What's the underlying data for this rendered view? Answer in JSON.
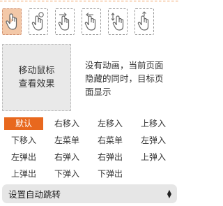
{
  "gestures": [
    {
      "icon": "hand-tap-icon",
      "active": true
    },
    {
      "icon": "hand-tap-circle-icon",
      "active": false
    },
    {
      "icon": "hand-swipe-right-icon",
      "active": false
    },
    {
      "icon": "hand-swipe-left-icon",
      "active": false
    },
    {
      "icon": "hand-swipe-vertical-icon",
      "active": false
    },
    {
      "icon": "hand-swipe-up-icon",
      "active": false
    }
  ],
  "preview": {
    "line1": "移动鼠标",
    "line2": "查看效果"
  },
  "description": {
    "line1": "没有动画，当前页面",
    "line2": "隐藏的同时，目标页",
    "line3": "面显示"
  },
  "options": [
    {
      "label": "默认",
      "active": true
    },
    {
      "label": "右移入"
    },
    {
      "label": "左移入"
    },
    {
      "label": "上移入"
    },
    {
      "label": "下移入"
    },
    {
      "label": "左菜单"
    },
    {
      "label": "右菜单"
    },
    {
      "label": "左弹入"
    },
    {
      "label": "左弹出"
    },
    {
      "label": "右弹入"
    },
    {
      "label": "右弹出"
    },
    {
      "label": "上弹入"
    },
    {
      "label": "上弹出"
    },
    {
      "label": "下弹入"
    },
    {
      "label": "下弹出"
    }
  ],
  "select": {
    "value": "设置自动跳转",
    "arrow_up": "▲",
    "arrow_down": "▼"
  },
  "colors": {
    "accent": "#e8681e",
    "active_gesture": "#f3c8a8"
  }
}
